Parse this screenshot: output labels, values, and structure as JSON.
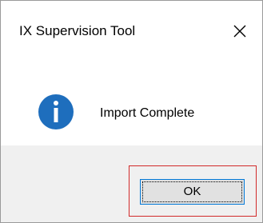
{
  "window": {
    "title": "IX Supervision Tool",
    "close_icon": "close-icon"
  },
  "message": {
    "icon": "info-icon",
    "text": "Import Complete"
  },
  "buttons": {
    "ok_label": "OK"
  },
  "colors": {
    "info_icon_fill": "#1e6ebd",
    "ok_button_border": "#0078d7",
    "ok_button_bg": "#e1e1e1",
    "footer_bg": "#f0f0f0",
    "highlight_border": "#d22a2a"
  }
}
